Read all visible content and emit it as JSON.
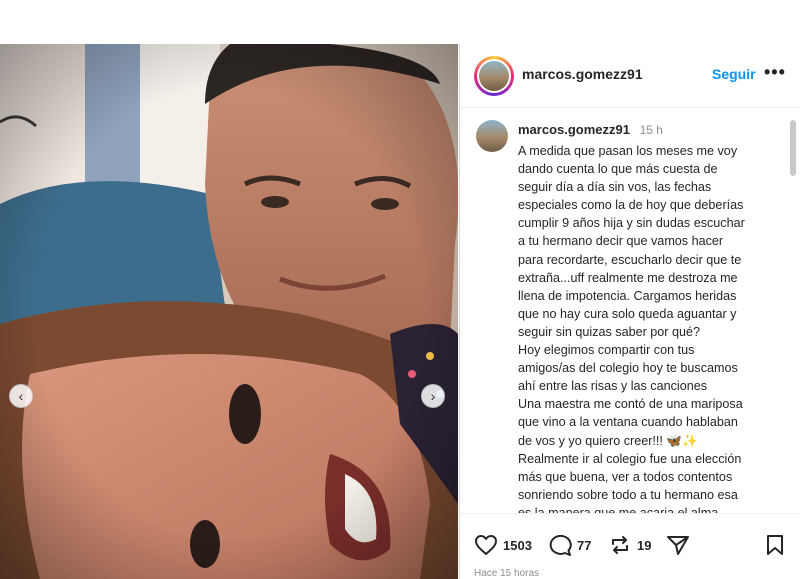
{
  "post": {
    "username": "marcos.gomezz91",
    "follow_label": "Seguir",
    "more_label": "•••",
    "carousel": {
      "prev_label": "‹",
      "next_label": "›"
    }
  },
  "caption": {
    "username": "marcos.gomezz91",
    "time": "15 h",
    "lines": [
      "A medida que pasan los meses me voy",
      "dando cuenta lo que más cuesta de",
      "seguir día a día sin vos, las fechas",
      "especiales como la de hoy que deberías",
      "cumplir 9 años hija y sin dudas escuchar",
      "a tu hermano decir que vamos hacer",
      "para recordarte, escucharlo decir que te",
      "extraña...uff realmente me destroza me",
      "llena de impotencia. Cargamos heridas",
      "que no hay cura solo queda aguantar y",
      "seguir sin quizas saber por qué?",
      "Hoy elegimos compartir con tus",
      "amigos/as del colegio hoy te buscamos",
      "ahí entre las risas y las canciones",
      "Una maestra me contó de una mariposa",
      "que vino a la ventana cuando hablaban",
      "de vos y yo quiero creer!!! 🦋✨",
      "Realmente ir al colegio fue una elección",
      "más que buena, ver a todos contentos",
      "sonriendo sobre todo a tu hermano esa",
      "es la manera que me acaria el alma"
    ]
  },
  "actions": {
    "likes": "1503",
    "comments": "77",
    "shares": "19",
    "icons": [
      "heart-icon",
      "comment-icon",
      "repost-icon",
      "send-icon",
      "bookmark-icon"
    ]
  },
  "time_ago": "Hace 15 horas",
  "colors": {
    "accent": "#0095f6",
    "text": "#262626",
    "muted": "#8e8e8e",
    "border": "#dbdbdb"
  }
}
